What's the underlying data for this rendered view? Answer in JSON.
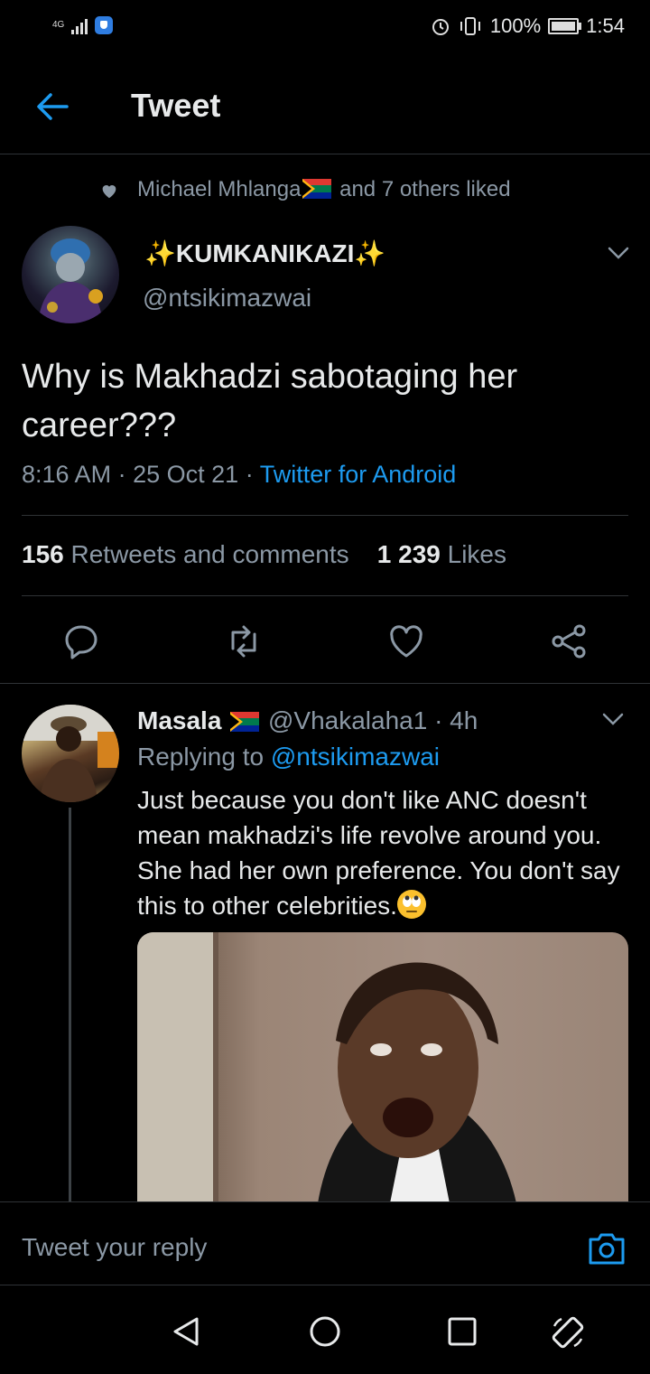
{
  "status_bar": {
    "network": "4G",
    "battery": "100%",
    "time": "1:54"
  },
  "header": {
    "title": "Tweet"
  },
  "liked_by": {
    "name": "Michael Mhlanga",
    "suffix": "and 7 others liked"
  },
  "author": {
    "name": "KUMKANIKAZI",
    "sparkle": "✨",
    "handle": "@ntsikimazwai"
  },
  "tweet": {
    "text": "Why is Makhadzi sabotaging her career???",
    "time": "8:16 AM",
    "date": "25 Oct 21",
    "source": "Twitter for Android",
    "sep": "·"
  },
  "stats": {
    "retweets_count": "156",
    "retweets_label": "Retweets and comments",
    "likes_count": "1 239",
    "likes_label": "Likes"
  },
  "reply": {
    "name": "Masala",
    "handle": "@Vhakalaha1",
    "age": "· 4h",
    "replying_prefix": "Replying to",
    "replying_to": "@ntsikimazwai",
    "text": "Just because you don't like ANC doesn't mean makhadzi's life revolve around you. She had her own preference. You don't say this to other celebrities."
  },
  "composer": {
    "placeholder": "Tweet your reply"
  },
  "colors": {
    "accent": "#1d9bf0",
    "muted": "#8b98a5",
    "background": "#000000"
  }
}
